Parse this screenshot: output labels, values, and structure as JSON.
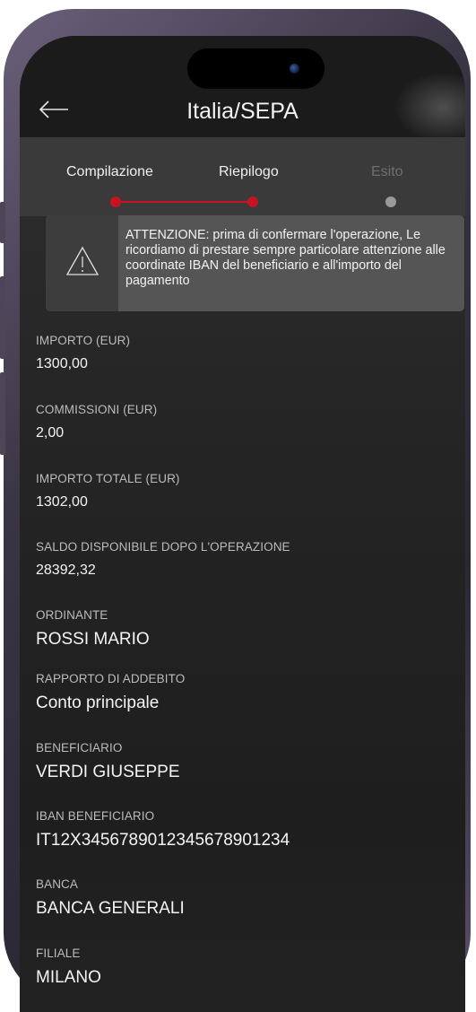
{
  "header": {
    "back_icon": "arrow-left-icon",
    "title": "Italia/SEPA"
  },
  "steps": [
    {
      "label": "Compilazione",
      "state": "done"
    },
    {
      "label": "Riepilogo",
      "state": "active"
    },
    {
      "label": "Esito",
      "state": "pending"
    }
  ],
  "colors": {
    "accent": "#c7131f",
    "pending_dot": "#9a9a9a"
  },
  "alert": {
    "icon": "warning-triangle-icon",
    "message": "ATTENZIONE: prima di confermare l'operazione, Le ricordiamo di prestare sempre particolare attenzione alle coordinate IBAN del beneficiario e all'importo del pagamento"
  },
  "fields": [
    {
      "label": "IMPORTO (EUR)",
      "value": "1300,00"
    },
    {
      "label": "COMMISSIONI (EUR)",
      "value": "2,00"
    },
    {
      "label": "IMPORTO TOTALE (EUR)",
      "value": "1302,00"
    },
    {
      "label": "SALDO DISPONIBILE DOPO L'OPERAZIONE",
      "value": "28392,32"
    },
    {
      "label": "ORDINANTE",
      "value": "ROSSI MARIO"
    },
    {
      "label": "RAPPORTO DI ADDEBITO",
      "value": "Conto principale"
    },
    {
      "label": "BENEFICIARIO",
      "value": "VERDI GIUSEPPE"
    },
    {
      "label": "IBAN BENEFICIARIO",
      "value": "IT12X3456789012345678901234"
    },
    {
      "label": "BANCA",
      "value": "BANCA GENERALI"
    },
    {
      "label": "FILIALE",
      "value": "MILANO"
    }
  ]
}
